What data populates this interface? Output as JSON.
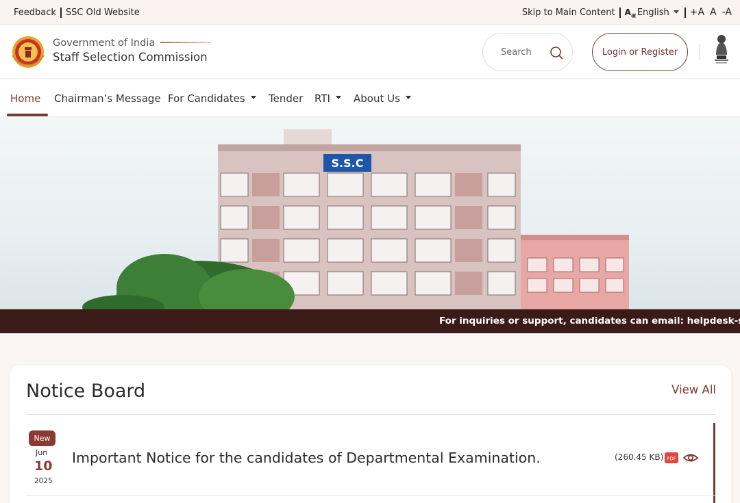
{
  "topbar": {
    "feedback": "Feedback",
    "old_website": "SSC Old Website",
    "skip": "Skip to Main Content",
    "language": "English",
    "font_increase": "+A",
    "font_normal": "A",
    "font_decrease": "-A"
  },
  "header": {
    "gov_label": "Government of India",
    "org_name": "Staff Selection Commission",
    "search_placeholder": "Search",
    "login_label": "Login or Register"
  },
  "nav": {
    "items": [
      "Home",
      "Chairman’s Message",
      "For Candidates",
      "Tender",
      "RTI",
      "About Us"
    ],
    "active": "Home"
  },
  "hero": {
    "building_sign": "S.S.C"
  },
  "ticker": {
    "text": "For inquiries or support, candidates can email: helpdesk-ssc@ssc"
  },
  "notice_board": {
    "title": "Notice Board",
    "view_all": "View All",
    "notices": [
      {
        "badge": "New",
        "month": "Jun",
        "day": "10",
        "year": "2025",
        "title": "Important Notice for the candidates of Departmental Examination.",
        "size": "(260.45 KB)",
        "file_type": "PDF"
      }
    ]
  },
  "colors": {
    "brand": "#7a3a30",
    "ticker_bg": "#3b1b17",
    "page_bg": "#fbf6f4"
  }
}
